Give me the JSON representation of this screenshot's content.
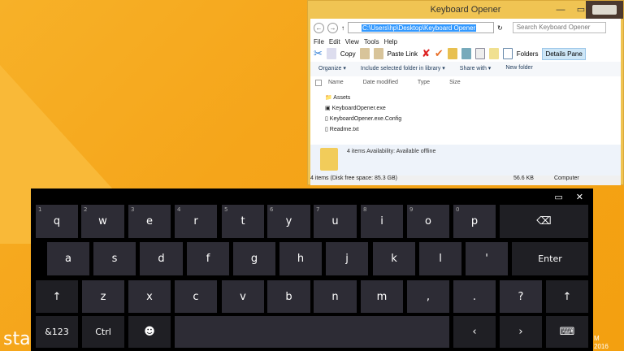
{
  "desktop": {
    "start_text": "star",
    "clock_line1": "M",
    "clock_line2": "2016"
  },
  "explorer": {
    "title": "Keyboard Opener",
    "path": "C:\\Users\\hp\\Desktop\\Keyboard Opener",
    "search_placeholder": "Search Keyboard Opener",
    "menu": [
      "File",
      "Edit",
      "View",
      "Tools",
      "Help"
    ],
    "toolbar": {
      "copy": "Copy",
      "paste_link": "Paste Link",
      "folders": "Folders",
      "details_pane": "Details Pane"
    },
    "commands": [
      "Organize ▾",
      "Include selected folder in library ▾",
      "Share with ▾",
      "New folder"
    ],
    "columns": [
      "Name",
      "Date modified",
      "Type",
      "Size"
    ],
    "files": [
      {
        "name": "Assets",
        "icon": "folder-icon"
      },
      {
        "name": "KeyboardOpener.exe",
        "icon": "exe-icon"
      },
      {
        "name": "KeyboardOpener.exe.Config",
        "icon": "file-icon"
      },
      {
        "name": "Readme.txt",
        "icon": "text-file-icon"
      }
    ],
    "details": "4 items  Availability:  Available offline",
    "status": {
      "items": "4 items (Disk free space: 85.3 GB)",
      "size": "56.6 KB",
      "location": "Computer"
    }
  },
  "keyboard": {
    "rows": [
      [
        {
          "l": "q",
          "h": "1"
        },
        {
          "l": "w",
          "h": "2"
        },
        {
          "l": "e",
          "h": "3"
        },
        {
          "l": "r",
          "h": "4"
        },
        {
          "l": "t",
          "h": "5"
        },
        {
          "l": "y",
          "h": "6"
        },
        {
          "l": "u",
          "h": "7"
        },
        {
          "l": "i",
          "h": "8"
        },
        {
          "l": "o",
          "h": "9"
        },
        {
          "l": "p",
          "h": "0"
        },
        {
          "l": "⌫",
          "fn": true,
          "n": "backspace"
        }
      ],
      [
        {
          "l": "a"
        },
        {
          "l": "s"
        },
        {
          "l": "d"
        },
        {
          "l": "f"
        },
        {
          "l": "g"
        },
        {
          "l": "h"
        },
        {
          "l": "j"
        },
        {
          "l": "k"
        },
        {
          "l": "l"
        },
        {
          "l": "'"
        },
        {
          "l": "Enter",
          "fn": true,
          "n": "enter"
        }
      ],
      [
        {
          "l": "↑",
          "fn": true,
          "n": "shift-left"
        },
        {
          "l": "z"
        },
        {
          "l": "x"
        },
        {
          "l": "c"
        },
        {
          "l": "v"
        },
        {
          "l": "b"
        },
        {
          "l": "n"
        },
        {
          "l": "m"
        },
        {
          "l": ","
        },
        {
          "l": "."
        },
        {
          "l": "?"
        },
        {
          "l": "↑",
          "fn": true,
          "n": "shift-right"
        }
      ],
      [
        {
          "l": "&123",
          "fn": true,
          "n": "symbols"
        },
        {
          "l": "Ctrl",
          "fn": true,
          "n": "ctrl"
        },
        {
          "l": "☻",
          "fn": true,
          "n": "emoji"
        },
        {
          "l": "",
          "n": "space"
        },
        {
          "l": "‹",
          "fn": true,
          "n": "left"
        },
        {
          "l": "›",
          "fn": true,
          "n": "right"
        },
        {
          "l": "⌨",
          "fn": true,
          "n": "keyboard-menu"
        }
      ]
    ],
    "minimize": "▭",
    "close": "✕"
  }
}
